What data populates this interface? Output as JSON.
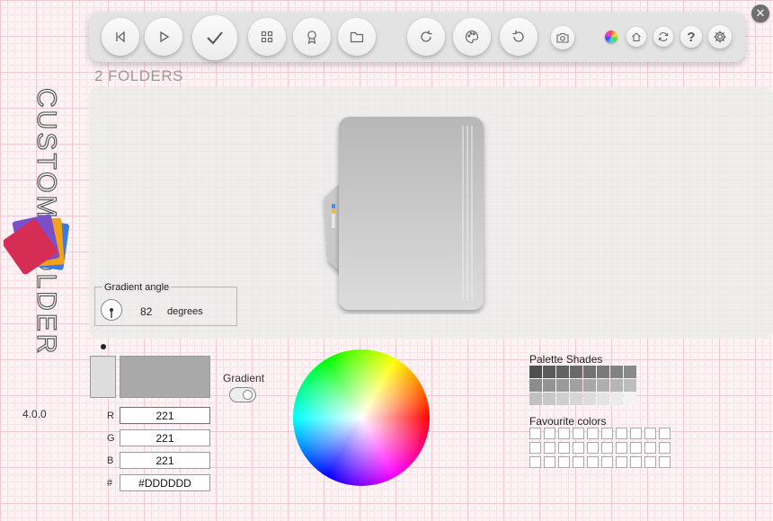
{
  "app": {
    "title": "CUSTOM FOLDER",
    "version": "4.0.0"
  },
  "toolbar": {
    "buttons": [
      {
        "name": "previous-button",
        "icon": "skip-back-icon"
      },
      {
        "name": "play-button",
        "icon": "play-icon"
      },
      {
        "name": "apply-button",
        "icon": "check-icon"
      },
      {
        "name": "grid-button",
        "icon": "grid-icon"
      },
      {
        "name": "badge-button",
        "icon": "award-icon"
      },
      {
        "name": "folder-button",
        "icon": "folder-icon"
      },
      {
        "name": "redo-button",
        "icon": "redo-icon"
      },
      {
        "name": "palette-button",
        "icon": "palette-icon"
      },
      {
        "name": "undo-button",
        "icon": "undo-icon"
      },
      {
        "name": "screenshot-button",
        "icon": "camera-icon"
      },
      {
        "name": "colors-button",
        "icon": "color-wheel-icon"
      },
      {
        "name": "home-button",
        "icon": "home-icon"
      },
      {
        "name": "refresh-button",
        "icon": "refresh-icon"
      },
      {
        "name": "help-button",
        "icon": "question-icon"
      },
      {
        "name": "settings-button",
        "icon": "gear-icon"
      }
    ],
    "help_glyph": "?"
  },
  "close_glyph": "✕",
  "folders_count": "2 FOLDERS",
  "gradient_angle": {
    "label": "Gradient angle",
    "value": "82",
    "unit": "degrees"
  },
  "color": {
    "primary_hex": "#DDDDDD",
    "secondary_hex": "#A9A9A9",
    "r_label": "R",
    "g_label": "G",
    "b_label": "B",
    "hex_label": "#",
    "r": "221",
    "g": "221",
    "b": "221",
    "hex": "#DDDDDD",
    "gradient_label": "Gradient",
    "gradient_on": false
  },
  "palette": {
    "title": "Palette Shades",
    "rows": [
      [
        "#4f4f4f",
        "#5a5a5a",
        "#626262",
        "#6a6a6a",
        "#727272",
        "#7a7a7a",
        "#828282",
        "#8a8a8a"
      ],
      [
        "#8c8c8c",
        "#939393",
        "#9a9a9a",
        "#a1a1a1",
        "#a8a8a8",
        "#afafaf",
        "#b6b6b6",
        "#bdbdbd"
      ],
      [
        "#c1c1c1",
        "#c8c8c8",
        "#cfcfcf",
        "#d6d6d6",
        "#dddddd",
        "#e4e4e4",
        "#ebebeb",
        "#f3f3f3"
      ]
    ]
  },
  "favourites": {
    "title": "Favourite colors",
    "rows": 3,
    "cols": 10
  }
}
